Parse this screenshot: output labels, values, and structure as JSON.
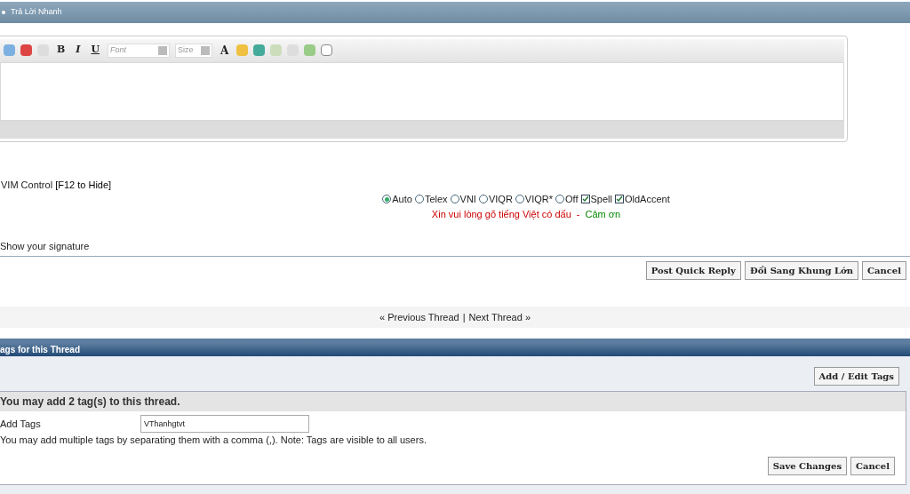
{
  "header": {
    "title": "Trả Lời Nhanh"
  },
  "toolbar": {
    "format_buttons": [
      "B",
      "I",
      "U"
    ],
    "font": {
      "placeholder": "Font"
    },
    "size": {
      "placeholder": "Size"
    },
    "text_size_button": "A"
  },
  "vim": {
    "label": "VIM Control",
    "hint": "[F12 to Hide]",
    "modes": [
      {
        "label": "Auto",
        "selected": true
      },
      {
        "label": "Telex",
        "selected": false
      },
      {
        "label": "VNI",
        "selected": false
      },
      {
        "label": "VIQR",
        "selected": false
      },
      {
        "label": "VIQR*",
        "selected": false
      },
      {
        "label": "Off",
        "selected": false
      }
    ],
    "options": [
      {
        "label": "Spell",
        "checked": true
      },
      {
        "label": "OldAccent",
        "checked": true
      }
    ],
    "notice": "Xin vui lòng gõ tiếng Việt có dấu",
    "separator": "-",
    "thanks": "Cảm ơn"
  },
  "signature": "Show your signature",
  "reply_buttons": [
    "Post Quick Reply",
    "Đổi Sang Khung Lớn",
    "Cancel"
  ],
  "thread_nav": {
    "previous": "« Previous Thread",
    "separator": "|",
    "next": "Next Thread »"
  },
  "tags": {
    "title": "ags for this Thread",
    "edit_button": "Add / Edit Tags",
    "notice": "You may add 2 tag(s) to this thread.",
    "field_label": "Add Tags",
    "field_value": "VThanhgtvt",
    "help": "You may add multiple tags by separating them with a comma (,). Note: Tags are visible to all users.",
    "buttons": [
      "Save Changes",
      "Cancel"
    ]
  }
}
